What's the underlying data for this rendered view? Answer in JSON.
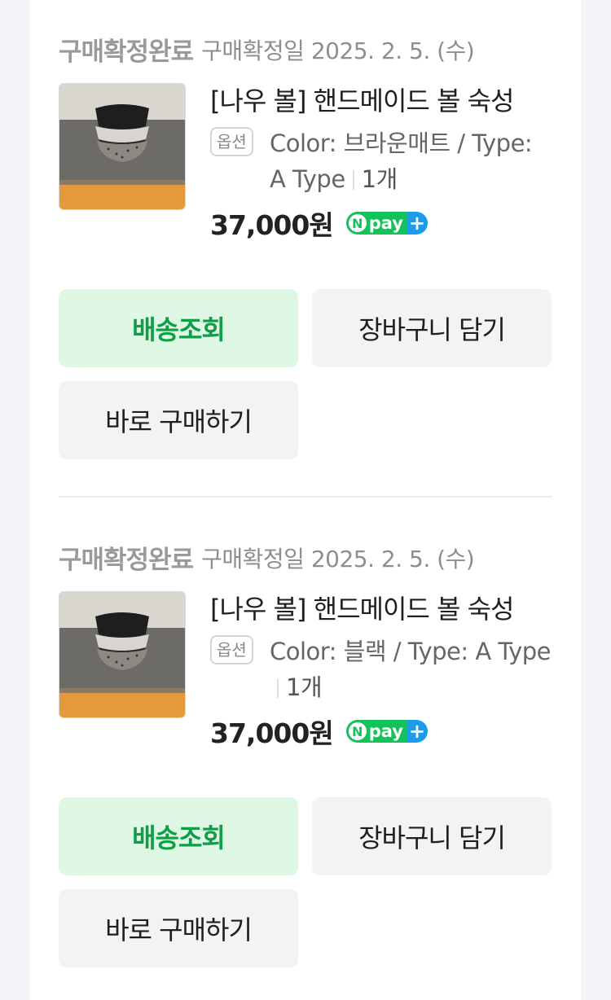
{
  "orders": [
    {
      "status": "구매확정완료",
      "confirm_date": "구매확정일 2025. 2. 5. (수)",
      "title": "[나우 볼] 핸드메이드 볼 숙성",
      "option_badge": "옵션",
      "option_text": "Color: 브라운매트 / Type: A Type",
      "quantity": "1개",
      "price": "37,000원",
      "npay_label": "pay",
      "npay_n": "N",
      "npay_plus": "+",
      "track_label": "배송조회",
      "cart_label": "장바구니 담기",
      "buy_label": "바로 구매하기"
    },
    {
      "status": "구매확정완료",
      "confirm_date": "구매확정일 2025. 2. 5. (수)",
      "title": "[나우 볼] 핸드메이드 볼 숙성",
      "option_badge": "옵션",
      "option_text": "Color: 블랙 / Type: A Type",
      "quantity": "1개",
      "price": "37,000원",
      "npay_label": "pay",
      "npay_n": "N",
      "npay_plus": "+",
      "track_label": "배송조회",
      "cart_label": "장바구니 담기",
      "buy_label": "바로 구매하기"
    }
  ],
  "colors": {
    "track_bg": "#dff8e6",
    "track_text": "#0e9f44",
    "npay_green": "#14c25a",
    "npay_blue": "#1a9ce8"
  }
}
